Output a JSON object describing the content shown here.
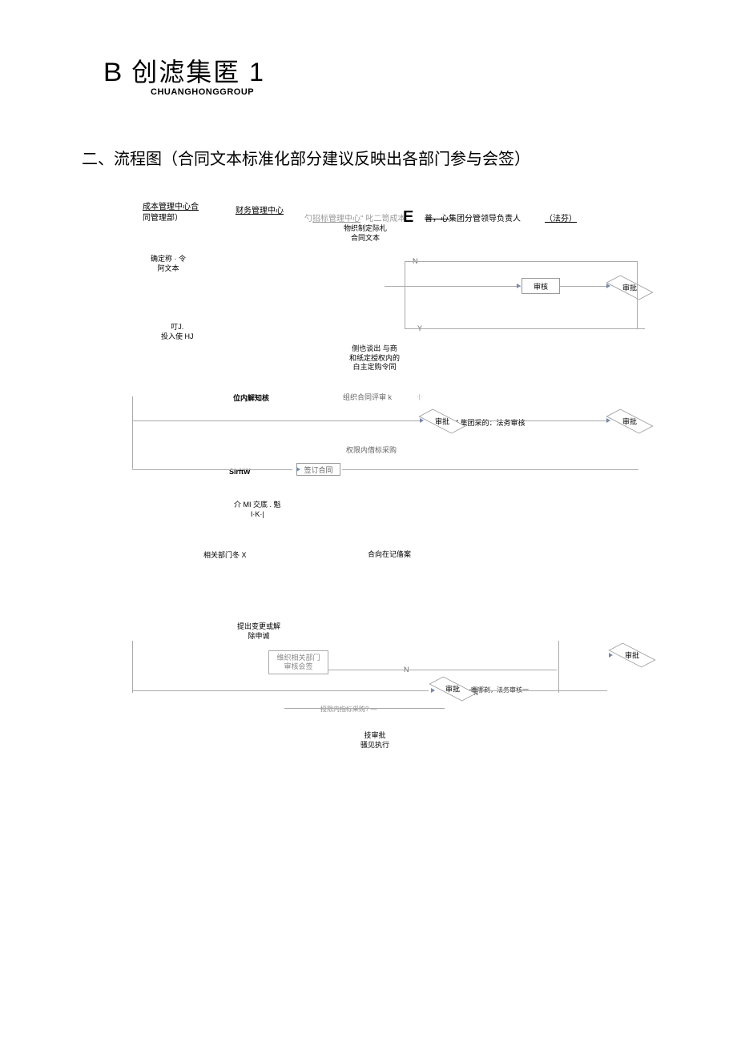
{
  "logo": {
    "prefix": "B",
    "main": "创滤集匿 1",
    "sub": "CHUANGHONGGROUP"
  },
  "section_heading": "二、流程图（合同文本标准化部分建议反映出各部门参与会签）",
  "lanes": {
    "lane1": "成本管理中心合",
    "lane1_sub": "同管理部）",
    "lane2": "财务管理中心",
    "lane3_prefix": "勺",
    "lane3_u": "招标管理中心",
    "lane3_suffix": "\" 叱二笥成本",
    "lane3b": "E",
    "lane4_prefix": "普，心",
    "lane4_normal": "集团分管领导负责人",
    "lane5": "（法芬）"
  },
  "flow": {
    "制定标准": "物织制定际札\n合同文本",
    "确定合同文本": "确定称 · 令\n阿文本",
    "投入使用": "叮J.\n投入使 HJ",
    "谈判授权": "侧也谈出 与商\n和纸定授权内的\n白主定购令同",
    "位内解知核": "位内解知核",
    "组织合同评审": "组织合同评审 k",
    "授限内招标采购": "权限内借标采购",
    "SirftW": "SirftW",
    "签订合同": "签订合同",
    "合同交底": "介 MI 交底 . 魁\nI·K·|",
    "相关部门": "相关部门冬 X",
    "合同备案": "合向在记俻案",
    "变更解除": "提出变更或解\n除申诚",
    "组织会签": "维织相关部门\n审核会签",
    "技审批执行": "技审批\n骚见执行",
    "授限内招标2": "授限内指标采购? —",
    "集团法务1": "集团采的：法务审核",
    "集团法务2": "哪哪剃，法务审核一",
    "审核": "审核",
    "审批": "审批"
  },
  "yn": {
    "N": "N",
    "Y": "Y",
    "Yj": "Y集",
    "ow": "·|·"
  }
}
